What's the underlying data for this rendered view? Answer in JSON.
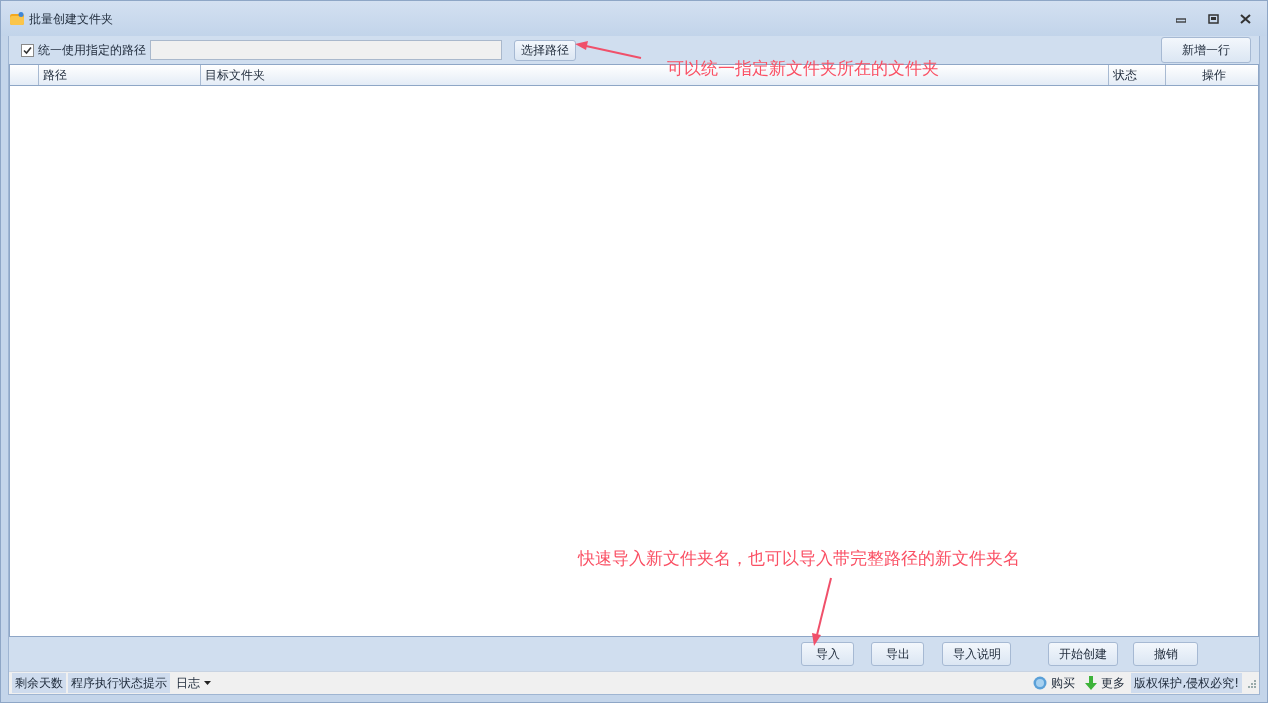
{
  "window": {
    "title": "批量创建文件夹"
  },
  "toolbar": {
    "use_path_label": "统一使用指定的路径",
    "use_path_checked": true,
    "choose_button": "选择路径",
    "add_row_button": "新增一行"
  },
  "table": {
    "columns": [
      "",
      "路径",
      "目标文件夹",
      "状态",
      "操作"
    ]
  },
  "buttons": [
    "导入",
    "导出",
    "导入说明",
    "开始创建",
    "撤销"
  ],
  "status_bar": {
    "left": [
      "剩余天数",
      "程序执行状态提示"
    ],
    "log_menu": "日志",
    "buy": "购买",
    "more": "更多",
    "copyright": "版权保护,侵权必究!"
  },
  "annotations": [
    {
      "text": "可以统一指定新文件夹所在的文件夹"
    },
    {
      "text": "快速导入新文件夹名，也可以导入带完整路径的新文件夹名"
    }
  ]
}
